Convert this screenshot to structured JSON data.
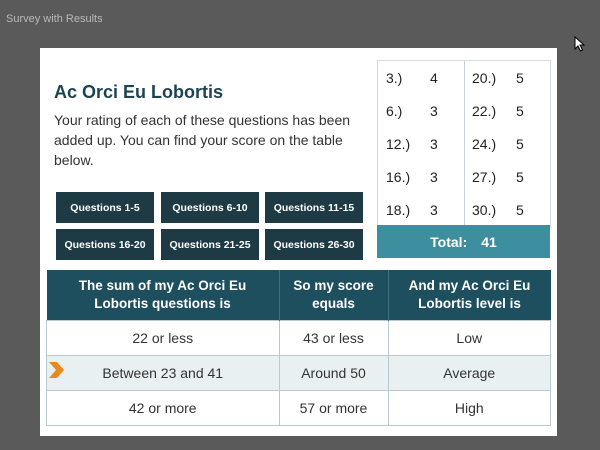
{
  "window": {
    "title": "Survey with Results"
  },
  "slide": {
    "heading": "Ac Orci Eu Lobortis",
    "intro": "Your rating of each of these questions has been added up. You can find your score on the table below."
  },
  "buttons": [
    "Questions 1-5",
    "Questions 6-10",
    "Questions 11-15",
    "Questions 16-20",
    "Questions 21-25",
    "Questions 26-30"
  ],
  "scores": {
    "left": [
      {
        "q": "3.)",
        "v": "4"
      },
      {
        "q": "6.)",
        "v": "3"
      },
      {
        "q": "12.)",
        "v": "3"
      },
      {
        "q": "16.)",
        "v": "3"
      },
      {
        "q": "18.)",
        "v": "3"
      }
    ],
    "right": [
      {
        "q": "20.)",
        "v": "5"
      },
      {
        "q": "22.)",
        "v": "5"
      },
      {
        "q": "24.)",
        "v": "5"
      },
      {
        "q": "27.)",
        "v": "5"
      },
      {
        "q": "30.)",
        "v": "5"
      }
    ],
    "total_label": "Total:",
    "total_value": "41"
  },
  "results_table": {
    "headers": [
      "The sum of my Ac Orci Eu Lobortis questions is",
      "So my score equals",
      "And my Ac Orci Eu Lobortis level is"
    ],
    "rows": [
      [
        "22 or less",
        "43 or less",
        "Low"
      ],
      [
        "Between 23 and 41",
        "Around 50",
        "Average"
      ],
      [
        "42 or more",
        "57 or more",
        "High"
      ]
    ]
  },
  "colors": {
    "button_bg": "#1e3a45",
    "header_bg": "#1e4f5e",
    "total_bg": "#3d8fa0",
    "highlight_arrow": "#e8891f"
  }
}
